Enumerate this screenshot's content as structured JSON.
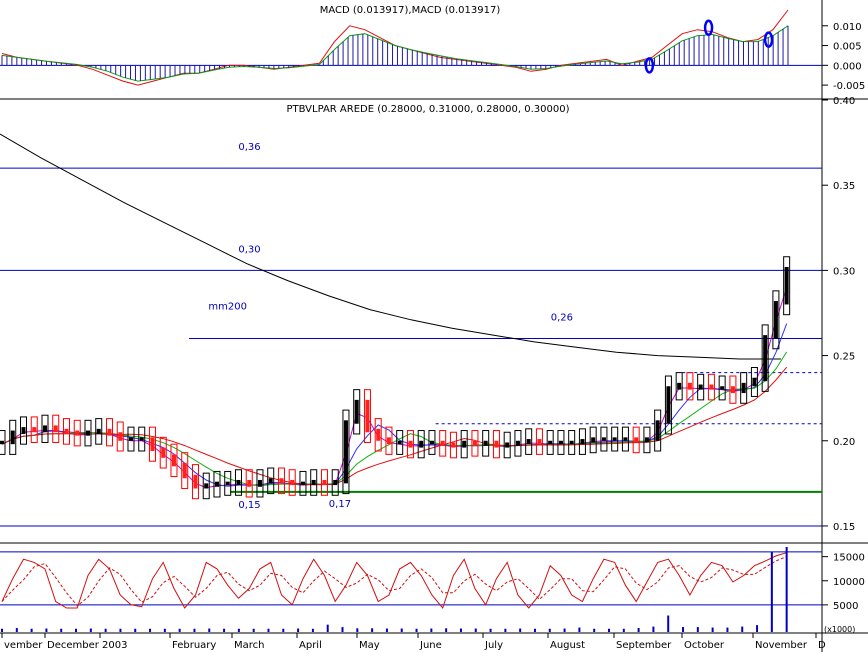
{
  "chart_data": [
    {
      "type": "line",
      "panel": "macd",
      "title": "MACD (0.013917),MACD (0.013917)",
      "ylim": [
        -0.007,
        0.015
      ],
      "yticks": [
        {
          "value": 0.01,
          "label": "0.010"
        },
        {
          "value": 0.005,
          "label": "0.005"
        },
        {
          "value": 0.0,
          "label": "0.000"
        },
        {
          "value": -0.005,
          "label": "-0.005"
        }
      ],
      "grid": false,
      "colors": {
        "histogram": "#1a1aa8",
        "macd": "#e01010",
        "signal": "#10a010",
        "zero": "#0000c0",
        "markers": "#0000ff"
      },
      "series": [
        {
          "color": "#e01010",
          "values": [
            0.003,
            0.002,
            0.0015,
            0.001,
            0.0005,
            0.0,
            -0.001,
            -0.0025,
            -0.004,
            -0.005,
            -0.004,
            -0.003,
            -0.002,
            -0.002,
            -0.001,
            0.0,
            0.0,
            -0.0005,
            -0.001,
            -0.0005,
            0.0,
            0.0005,
            0.006,
            0.01,
            0.009,
            0.007,
            0.005,
            0.004,
            0.003,
            0.002,
            0.0015,
            0.001,
            0.0005,
            0.0,
            -0.0005,
            -0.0015,
            -0.001,
            0.0,
            0.0005,
            0.001,
            0.0015,
            0.0,
            0.001,
            0.002,
            0.005,
            0.008,
            0.009,
            0.0085,
            0.007,
            0.006,
            0.0065,
            0.009,
            0.014
          ]
        },
        {
          "color": "#10a010",
          "values": [
            0.0025,
            0.002,
            0.0015,
            0.001,
            0.0006,
            0.0002,
            -0.0005,
            -0.0015,
            -0.003,
            -0.004,
            -0.0035,
            -0.003,
            -0.0022,
            -0.002,
            -0.0012,
            -0.0005,
            -0.0003,
            -0.0005,
            -0.0008,
            -0.0006,
            -0.0002,
            0.0002,
            0.004,
            0.0075,
            0.008,
            0.0065,
            0.005,
            0.004,
            0.0032,
            0.0024,
            0.0017,
            0.0012,
            0.0007,
            0.0002,
            -0.0003,
            -0.001,
            -0.0008,
            -0.0002,
            0.0003,
            0.0007,
            0.0011,
            0.0004,
            0.0008,
            0.0015,
            0.0038,
            0.0062,
            0.0075,
            0.0078,
            0.0068,
            0.006,
            0.006,
            0.0075,
            0.01
          ]
        }
      ],
      "markers": [
        {
          "x": 0.79,
          "y": 0.0
        },
        {
          "x": 0.862,
          "y": 0.0095
        },
        {
          "x": 0.935,
          "y": 0.0065
        }
      ]
    },
    {
      "type": "line",
      "panel": "price",
      "title": "PTBVLPAR AREDE (0.28000, 0.31000, 0.28000, 0.30000)",
      "ylim": [
        0.14,
        0.4
      ],
      "yticks": [
        {
          "value": 0.4,
          "label": "0.40"
        },
        {
          "value": 0.35,
          "label": "0.35"
        },
        {
          "value": 0.3,
          "label": "0.30"
        },
        {
          "value": 0.25,
          "label": "0.25"
        },
        {
          "value": 0.2,
          "label": "0.20"
        },
        {
          "value": 0.15,
          "label": "0.15"
        }
      ],
      "grid": false,
      "colors": {
        "up": "#000000",
        "down": "#ff0000",
        "hline": "#0000c0",
        "support": "#008000",
        "mm200": "#000000",
        "ma_magenta": "#d000d0",
        "ma_blue": "#3030ff",
        "ma_green": "#10b010",
        "ma_red": "#e01010"
      },
      "x": [
        "November",
        "December",
        "2003",
        "February",
        "March",
        "April",
        "May",
        "June",
        "July",
        "August",
        "September",
        "October",
        "November",
        "D"
      ],
      "hlines": [
        {
          "value": 0.36,
          "label": "0,36",
          "label_x": 0.29
        },
        {
          "value": 0.3,
          "label": "0,30",
          "label_x": 0.29
        },
        {
          "value": 0.26,
          "label": "0,26",
          "label_x": 0.67,
          "from": 0.23
        },
        {
          "value": 0.17,
          "label": "0,17",
          "label_x": 0.4,
          "from": 0.28,
          "support": true
        },
        {
          "value": 0.15,
          "label": "0,15",
          "label_x": 0.29
        }
      ],
      "dashed": [
        {
          "value": 0.24,
          "from": 0.83
        },
        {
          "value": 0.21,
          "from": 0.53
        }
      ],
      "mm200": {
        "label": "mm200",
        "label_x": 0.29,
        "label_value": 0.277,
        "x": [
          0.0,
          0.05,
          0.1,
          0.15,
          0.2,
          0.25,
          0.3,
          0.35,
          0.4,
          0.45,
          0.5,
          0.55,
          0.6,
          0.65,
          0.7,
          0.75,
          0.8,
          0.85,
          0.9,
          0.95
        ],
        "values": [
          0.38,
          0.366,
          0.353,
          0.34,
          0.328,
          0.316,
          0.304,
          0.294,
          0.285,
          0.277,
          0.271,
          0.266,
          0.262,
          0.258,
          0.255,
          0.252,
          0.25,
          0.249,
          0.248,
          0.248
        ]
      },
      "closes": [
        0.198,
        0.204,
        0.206,
        0.205,
        0.207,
        0.205,
        0.204,
        0.203,
        0.204,
        0.205,
        0.203,
        0.2,
        0.2,
        0.2,
        0.194,
        0.19,
        0.185,
        0.178,
        0.172,
        0.173,
        0.174,
        0.174,
        0.175,
        0.173,
        0.175,
        0.176,
        0.175,
        0.174,
        0.174,
        0.175,
        0.174,
        0.175,
        0.21,
        0.222,
        0.205,
        0.2,
        0.198,
        0.198,
        0.196,
        0.198,
        0.198,
        0.197,
        0.196,
        0.198,
        0.197,
        0.198,
        0.196,
        0.197,
        0.198,
        0.199,
        0.198,
        0.198,
        0.198,
        0.198,
        0.199,
        0.2,
        0.2,
        0.2,
        0.2,
        0.199,
        0.2,
        0.21,
        0.23,
        0.232,
        0.23,
        0.231,
        0.23,
        0.23,
        0.228,
        0.232,
        0.235,
        0.26,
        0.28,
        0.3
      ]
    },
    {
      "type": "line",
      "panel": "stochastic_volume",
      "ylim": [
        0,
        17000
      ],
      "yticks": [
        {
          "value": 15000,
          "label": "15000"
        },
        {
          "value": 10000,
          "label": "10000"
        },
        {
          "value": 5000,
          "label": "5000"
        },
        {
          "value": 0,
          "label": "(x1000)"
        }
      ],
      "grid": false,
      "colors": {
        "stoch": "#d01010",
        "signal": "#d01010",
        "volume": "#0000c0",
        "band": "#0000c0"
      },
      "bands": [
        16000,
        5000
      ],
      "stoch_pct": [
        20,
        55,
        85,
        80,
        70,
        20,
        10,
        10,
        60,
        85,
        70,
        30,
        15,
        12,
        55,
        80,
        40,
        10,
        30,
        80,
        70,
        45,
        25,
        40,
        70,
        80,
        30,
        15,
        55,
        85,
        60,
        20,
        45,
        80,
        60,
        20,
        30,
        70,
        80,
        60,
        30,
        10,
        60,
        85,
        40,
        15,
        55,
        80,
        30,
        10,
        30,
        75,
        60,
        30,
        20,
        55,
        85,
        80,
        45,
        20,
        50,
        80,
        85,
        60,
        30,
        60,
        80,
        75,
        50,
        60,
        75,
        82,
        90,
        95
      ],
      "volume": [
        0.05,
        0.2,
        0.05,
        0.1,
        0.05,
        0.05,
        0.1,
        0.05,
        0.05,
        0.05,
        0.05,
        0.05,
        0.05,
        0.05,
        0.1,
        0.05,
        0.05,
        0.05,
        0.05,
        0.05,
        0.1,
        0.05,
        0.9,
        0.4,
        0.15,
        0.15,
        0.1,
        0.1,
        0.05,
        0.1,
        0.15,
        0.1,
        0.1,
        0.05,
        0.05,
        0.1,
        0.05,
        0.05,
        0.1,
        0.3,
        0.05,
        0.05,
        0.05,
        0.2,
        0.5,
        2.8,
        0.4,
        0.4,
        0.3,
        0.3,
        0.5,
        0.8,
        16.0,
        17.0
      ],
      "x_labels": [
        "vember",
        "December",
        "2003",
        "February",
        "March",
        "April",
        "May",
        "June",
        "July",
        "August",
        "September",
        "October",
        "November",
        "D"
      ]
    }
  ]
}
